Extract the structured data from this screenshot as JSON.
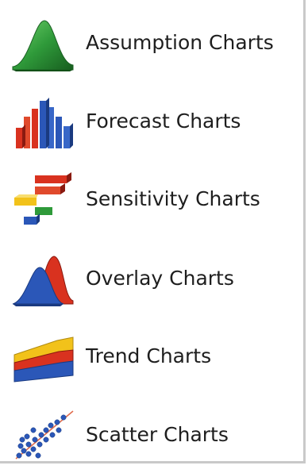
{
  "menu": {
    "items": [
      {
        "label": "Assumption Charts",
        "icon": "assumption-chart-icon"
      },
      {
        "label": "Forecast Charts",
        "icon": "forecast-chart-icon"
      },
      {
        "label": "Sensitivity Charts",
        "icon": "sensitivity-chart-icon"
      },
      {
        "label": "Overlay Charts",
        "icon": "overlay-chart-icon"
      },
      {
        "label": "Trend Charts",
        "icon": "trend-chart-icon"
      },
      {
        "label": "Scatter Charts",
        "icon": "scatter-chart-icon"
      }
    ]
  },
  "colors": {
    "text": "#1e1e1e",
    "border": "#c9c9c9",
    "green": "#2f9a3a",
    "blue": "#2b57b8",
    "red": "#d9321f",
    "yellow": "#f2c21a"
  }
}
